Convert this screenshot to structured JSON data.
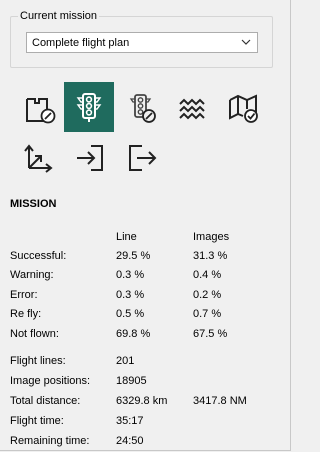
{
  "mission_group": {
    "title": "Current mission",
    "selected": "Complete flight plan"
  },
  "toolbar": {
    "tools": [
      {
        "icon": "map-edit-icon"
      },
      {
        "icon": "traffic-light-icon",
        "active": true
      },
      {
        "icon": "traffic-light-edit-icon"
      },
      {
        "icon": "zigzag-lines-icon"
      },
      {
        "icon": "map-check-icon"
      },
      {
        "icon": "axis-arrows-icon"
      },
      {
        "icon": "import-icon"
      },
      {
        "icon": "export-icon"
      }
    ]
  },
  "mission": {
    "heading": "MISSION",
    "columns": [
      "Line",
      "Images"
    ],
    "rows": [
      {
        "label": "Successful:",
        "line": "29.5 %",
        "images": "31.3 %"
      },
      {
        "label": "Warning:",
        "line": "0.3 %",
        "images": "0.4 %"
      },
      {
        "label": "Error:",
        "line": "0.3 %",
        "images": "0.2 %"
      },
      {
        "label": "Re fly:",
        "line": "0.5 %",
        "images": "0.7 %"
      },
      {
        "label": "Not flown:",
        "line": "69.8 %",
        "images": "67.5 %"
      }
    ],
    "stats": [
      {
        "label": "Flight lines:",
        "value": "201",
        "extra": ""
      },
      {
        "label": "Image positions:",
        "value": "18905",
        "extra": ""
      },
      {
        "label": "Total distance:",
        "value": "6329.8 km",
        "extra": "3417.8 NM"
      },
      {
        "label": "Flight time:",
        "value": "35:17",
        "extra": ""
      },
      {
        "label": "Remaining time:",
        "value": "24:50",
        "extra": ""
      }
    ]
  }
}
